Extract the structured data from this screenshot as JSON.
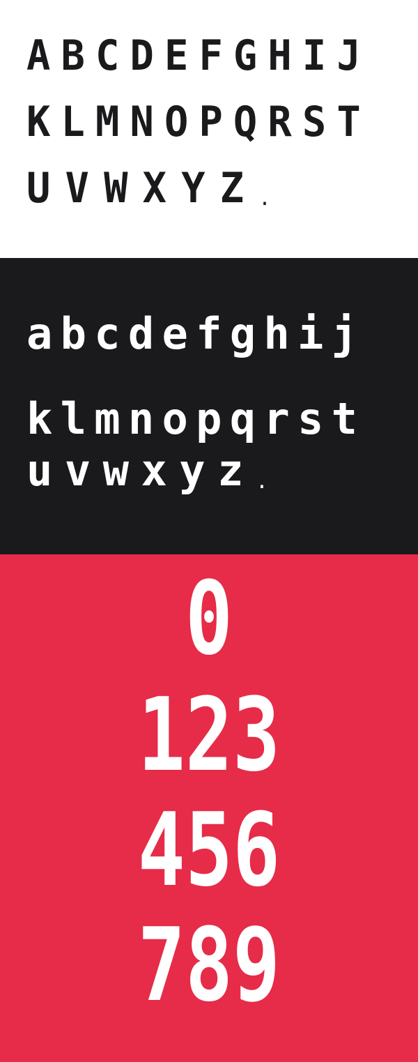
{
  "colors": {
    "panel_upper_bg": "#ffffff",
    "panel_upper_fg": "#1a1a1c",
    "panel_lower_bg": "#1a1a1c",
    "panel_lower_fg": "#ffffff",
    "panel_digits_bg": "#e62c48",
    "panel_digits_fg": "#ffffff"
  },
  "uppercase": {
    "rows": [
      [
        "A",
        "B",
        "C",
        "D",
        "E",
        "F",
        "G",
        "H",
        "I",
        "J"
      ],
      [
        "K",
        "L",
        "M",
        "N",
        "O",
        "P",
        "Q",
        "R",
        "S",
        "T"
      ],
      [
        "U",
        "V",
        "W",
        "X",
        "Y",
        "Z",
        "."
      ]
    ]
  },
  "lowercase": {
    "rows": [
      [
        "a",
        "b",
        "c",
        "d",
        "e",
        "f",
        "g",
        "h",
        "i",
        "j"
      ],
      [
        "k",
        "l",
        "m",
        "n",
        "o",
        "p",
        "q",
        "r",
        "s",
        "t"
      ],
      [
        "u",
        "v",
        "w",
        "x",
        "y",
        "z",
        "."
      ]
    ]
  },
  "digits": {
    "rows": [
      [
        "0"
      ],
      [
        "1",
        "2",
        "3"
      ],
      [
        "4",
        "5",
        "6"
      ],
      [
        "7",
        "8",
        "9"
      ]
    ]
  }
}
